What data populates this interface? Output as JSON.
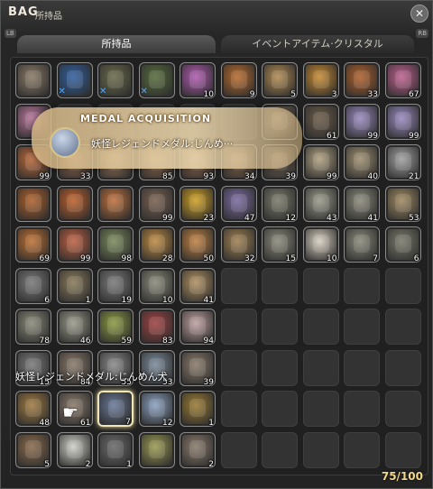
{
  "window": {
    "title": "BAG",
    "subtitle": "所持品",
    "counter": "75/100"
  },
  "buttons": {
    "lb": "LB",
    "rb": "RB",
    "close_icon": "close-icon"
  },
  "tabs": [
    {
      "label": "所持品",
      "active": true
    },
    {
      "label": "イベントアイテム·クリスタル",
      "active": false
    }
  ],
  "toast": {
    "heading": "MEDAL ACQUISITION",
    "text": "妖怪レジェンドメダル:じんめ···",
    "icon": "medal-icon"
  },
  "tooltip": {
    "text": "妖怪レジェンドメダル:じんめん犬"
  },
  "cursor": {
    "icon": "pointing-hand-icon"
  },
  "colors": {
    "accent": "#f2d88a",
    "panel": "#232323",
    "slot_empty": "#3a3a3a",
    "x_mark": "#4ea8ff"
  },
  "slots": [
    {
      "r": 0,
      "c": 0,
      "icon": "wand",
      "qty": "",
      "x": false,
      "color": "#8a7a66"
    },
    {
      "r": 0,
      "c": 1,
      "icon": "blue-horned-gear",
      "qty": "",
      "x": true,
      "color": "#2f5fa0"
    },
    {
      "r": 0,
      "c": 2,
      "icon": "dark-blue-gear",
      "qty": "",
      "x": true,
      "color": "#6a6a4a"
    },
    {
      "r": 0,
      "c": 3,
      "icon": "green-gear",
      "qty": "",
      "x": true,
      "color": "#556b3a"
    },
    {
      "r": 0,
      "c": 4,
      "icon": "pink-potion",
      "qty": "10",
      "x": false,
      "color": "#b05ab0"
    },
    {
      "r": 0,
      "c": 5,
      "icon": "soup",
      "qty": "9",
      "x": false,
      "color": "#b86a2a"
    },
    {
      "r": 0,
      "c": 6,
      "icon": "bread",
      "qty": "5",
      "x": false,
      "color": "#b08a50"
    },
    {
      "r": 0,
      "c": 7,
      "icon": "pie",
      "qty": "3",
      "x": false,
      "color": "#c88a30"
    },
    {
      "r": 0,
      "c": 8,
      "icon": "stew",
      "qty": "33",
      "x": false,
      "color": "#b0602a"
    },
    {
      "r": 0,
      "c": 9,
      "icon": "pink-egg",
      "qty": "67",
      "x": false,
      "color": "#c06090"
    },
    {
      "r": 1,
      "c": 0,
      "icon": "potion",
      "qty": "",
      "x": false,
      "color": "#c07aa0"
    },
    {
      "r": 1,
      "c": 6,
      "icon": "cloth",
      "qty": "",
      "x": false,
      "color": "#8a7a66"
    },
    {
      "r": 1,
      "c": 7,
      "icon": "rod",
      "qty": "61",
      "x": false,
      "color": "#6a5a46"
    },
    {
      "r": 1,
      "c": 8,
      "icon": "lavender-cloth",
      "qty": "99",
      "x": false,
      "color": "#9a8ac0"
    },
    {
      "r": 1,
      "c": 9,
      "icon": "lavender-cloth",
      "qty": "99",
      "x": false,
      "color": "#9a8ac0"
    },
    {
      "r": 2,
      "c": 0,
      "icon": "orange-potion",
      "qty": "99",
      "x": false,
      "color": "#c06a3a"
    },
    {
      "r": 2,
      "c": 1,
      "icon": "potion",
      "qty": "33",
      "x": false,
      "color": "#b07a5a"
    },
    {
      "r": 2,
      "c": 2,
      "icon": "potion",
      "qty": "",
      "x": false,
      "color": "#c0906a"
    },
    {
      "r": 2,
      "c": 3,
      "icon": "potion",
      "qty": "85",
      "x": false,
      "color": "#b0805a"
    },
    {
      "r": 2,
      "c": 4,
      "icon": "potion",
      "qty": "93",
      "x": false,
      "color": "#b07a5a"
    },
    {
      "r": 2,
      "c": 5,
      "icon": "fruit",
      "qty": "34",
      "x": false,
      "color": "#a07a5a"
    },
    {
      "r": 2,
      "c": 6,
      "icon": "ore",
      "qty": "39",
      "x": false,
      "color": "#807060"
    },
    {
      "r": 2,
      "c": 7,
      "icon": "shards",
      "qty": "99",
      "x": false,
      "color": "#b0a080"
    },
    {
      "r": 2,
      "c": 8,
      "icon": "shards",
      "qty": "40",
      "x": false,
      "color": "#a09070"
    },
    {
      "r": 2,
      "c": 9,
      "icon": "crystals",
      "qty": "21",
      "x": false,
      "color": "#a0a0a0"
    },
    {
      "r": 3,
      "c": 0,
      "icon": "carrot",
      "qty": "",
      "x": false,
      "color": "#b0602a"
    },
    {
      "r": 3,
      "c": 1,
      "icon": "red-potion",
      "qty": "",
      "x": false,
      "color": "#c0602a"
    },
    {
      "r": 3,
      "c": 2,
      "icon": "red-potion",
      "qty": "",
      "x": false,
      "color": "#c0703a"
    },
    {
      "r": 3,
      "c": 3,
      "icon": "root",
      "qty": "99",
      "x": false,
      "color": "#7a6050"
    },
    {
      "r": 3,
      "c": 4,
      "icon": "yellow-crystal",
      "qty": "23",
      "x": false,
      "color": "#d0a020"
    },
    {
      "r": 3,
      "c": 5,
      "icon": "lavender",
      "qty": "47",
      "x": false,
      "color": "#7a6aa0"
    },
    {
      "r": 3,
      "c": 6,
      "icon": "ore",
      "qty": "12",
      "x": false,
      "color": "#7a7a6a"
    },
    {
      "r": 3,
      "c": 7,
      "icon": "ore",
      "qty": "43",
      "x": false,
      "color": "#9a9a8a"
    },
    {
      "r": 3,
      "c": 8,
      "icon": "ore",
      "qty": "41",
      "x": false,
      "color": "#8a8a7a"
    },
    {
      "r": 3,
      "c": 9,
      "icon": "ore",
      "qty": "53",
      "x": false,
      "color": "#a08a60"
    },
    {
      "r": 4,
      "c": 0,
      "icon": "dish",
      "qty": "69",
      "x": false,
      "color": "#c07030"
    },
    {
      "r": 4,
      "c": 1,
      "icon": "dish",
      "qty": "99",
      "x": false,
      "color": "#c06040"
    },
    {
      "r": 4,
      "c": 2,
      "icon": "cabbage",
      "qty": "98",
      "x": false,
      "color": "#7a8a5a"
    },
    {
      "r": 4,
      "c": 3,
      "icon": "dish",
      "qty": "28",
      "x": false,
      "color": "#c08a40"
    },
    {
      "r": 4,
      "c": 4,
      "icon": "pie",
      "qty": "50",
      "x": false,
      "color": "#c08040"
    },
    {
      "r": 4,
      "c": 5,
      "icon": "sack",
      "qty": "32",
      "x": false,
      "color": "#a08050"
    },
    {
      "r": 4,
      "c": 6,
      "icon": "coin",
      "qty": "15",
      "x": false,
      "color": "#8a8a7a"
    },
    {
      "r": 4,
      "c": 7,
      "icon": "letter",
      "qty": "10",
      "x": false,
      "color": "#d8d0c0"
    },
    {
      "r": 4,
      "c": 8,
      "icon": "stone",
      "qty": "7",
      "x": false,
      "color": "#8a8a7a"
    },
    {
      "r": 4,
      "c": 9,
      "icon": "pouch",
      "qty": "6",
      "x": false,
      "color": "#7a7a6a"
    },
    {
      "r": 5,
      "c": 0,
      "icon": "ring",
      "qty": "6",
      "x": false,
      "color": "#7a7a7a"
    },
    {
      "r": 5,
      "c": 1,
      "icon": "sandwich",
      "qty": "1",
      "x": false,
      "color": "#8a7a5a"
    },
    {
      "r": 5,
      "c": 2,
      "icon": "case",
      "qty": "19",
      "x": false,
      "color": "#7a7a7a"
    },
    {
      "r": 5,
      "c": 3,
      "icon": "case",
      "qty": "10",
      "x": false,
      "color": "#8a8a7a"
    },
    {
      "r": 5,
      "c": 4,
      "icon": "crate",
      "qty": "41",
      "x": false,
      "color": "#b09060"
    },
    {
      "r": 6,
      "c": 0,
      "icon": "coin",
      "qty": "78",
      "x": false,
      "color": "#8a8a7a"
    },
    {
      "r": 6,
      "c": 1,
      "icon": "coin",
      "qty": "46",
      "x": false,
      "color": "#9a9a8a"
    },
    {
      "r": 6,
      "c": 2,
      "icon": "cabbage",
      "qty": "59",
      "x": false,
      "color": "#8a9a40"
    },
    {
      "r": 6,
      "c": 3,
      "icon": "wine",
      "qty": "83",
      "x": false,
      "color": "#a04040"
    },
    {
      "r": 6,
      "c": 4,
      "icon": "gift-bag",
      "qty": "94",
      "x": false,
      "color": "#c0a0a0"
    },
    {
      "r": 7,
      "c": 0,
      "icon": "item",
      "qty": "15",
      "x": false,
      "color": "#7a7a7a"
    },
    {
      "r": 7,
      "c": 1,
      "icon": "item",
      "qty": "84",
      "x": false,
      "color": "#8a7a6a"
    },
    {
      "r": 7,
      "c": 2,
      "icon": "item",
      "qty": "55",
      "x": false,
      "color": "#8a8a8a"
    },
    {
      "r": 7,
      "c": 3,
      "icon": "item",
      "qty": "53",
      "x": false,
      "color": "#7a8a9a"
    },
    {
      "r": 7,
      "c": 4,
      "icon": "item",
      "qty": "39",
      "x": false,
      "color": "#8a7a6a"
    },
    {
      "r": 8,
      "c": 0,
      "icon": "basket",
      "qty": "48",
      "x": false,
      "color": "#a07a40"
    },
    {
      "r": 8,
      "c": 1,
      "icon": "hand-slot",
      "qty": "61",
      "x": false,
      "color": "#8a7a6a"
    },
    {
      "r": 8,
      "c": 2,
      "icon": "yokai-medal",
      "qty": "7",
      "x": false,
      "color": "#6a7a9a",
      "selected": true
    },
    {
      "r": 8,
      "c": 3,
      "icon": "blue-coin",
      "qty": "12",
      "x": false,
      "color": "#8aa0c0"
    },
    {
      "r": 8,
      "c": 4,
      "icon": "pot",
      "qty": "1",
      "x": false,
      "color": "#9a7a30"
    },
    {
      "r": 9,
      "c": 0,
      "icon": "basket",
      "qty": "5",
      "x": false,
      "color": "#8a6a4a"
    },
    {
      "r": 9,
      "c": 1,
      "icon": "cotton",
      "qty": "2",
      "x": false,
      "color": "#d0d0c8"
    },
    {
      "r": 9,
      "c": 2,
      "icon": "scissors",
      "qty": "1",
      "x": false,
      "color": "#6a6a6a"
    },
    {
      "r": 9,
      "c": 3,
      "icon": "package",
      "qty": "",
      "x": false,
      "color": "#9a9a50"
    },
    {
      "r": 9,
      "c": 4,
      "icon": "horn",
      "qty": "2",
      "x": false,
      "color": "#8a7a6a"
    }
  ]
}
